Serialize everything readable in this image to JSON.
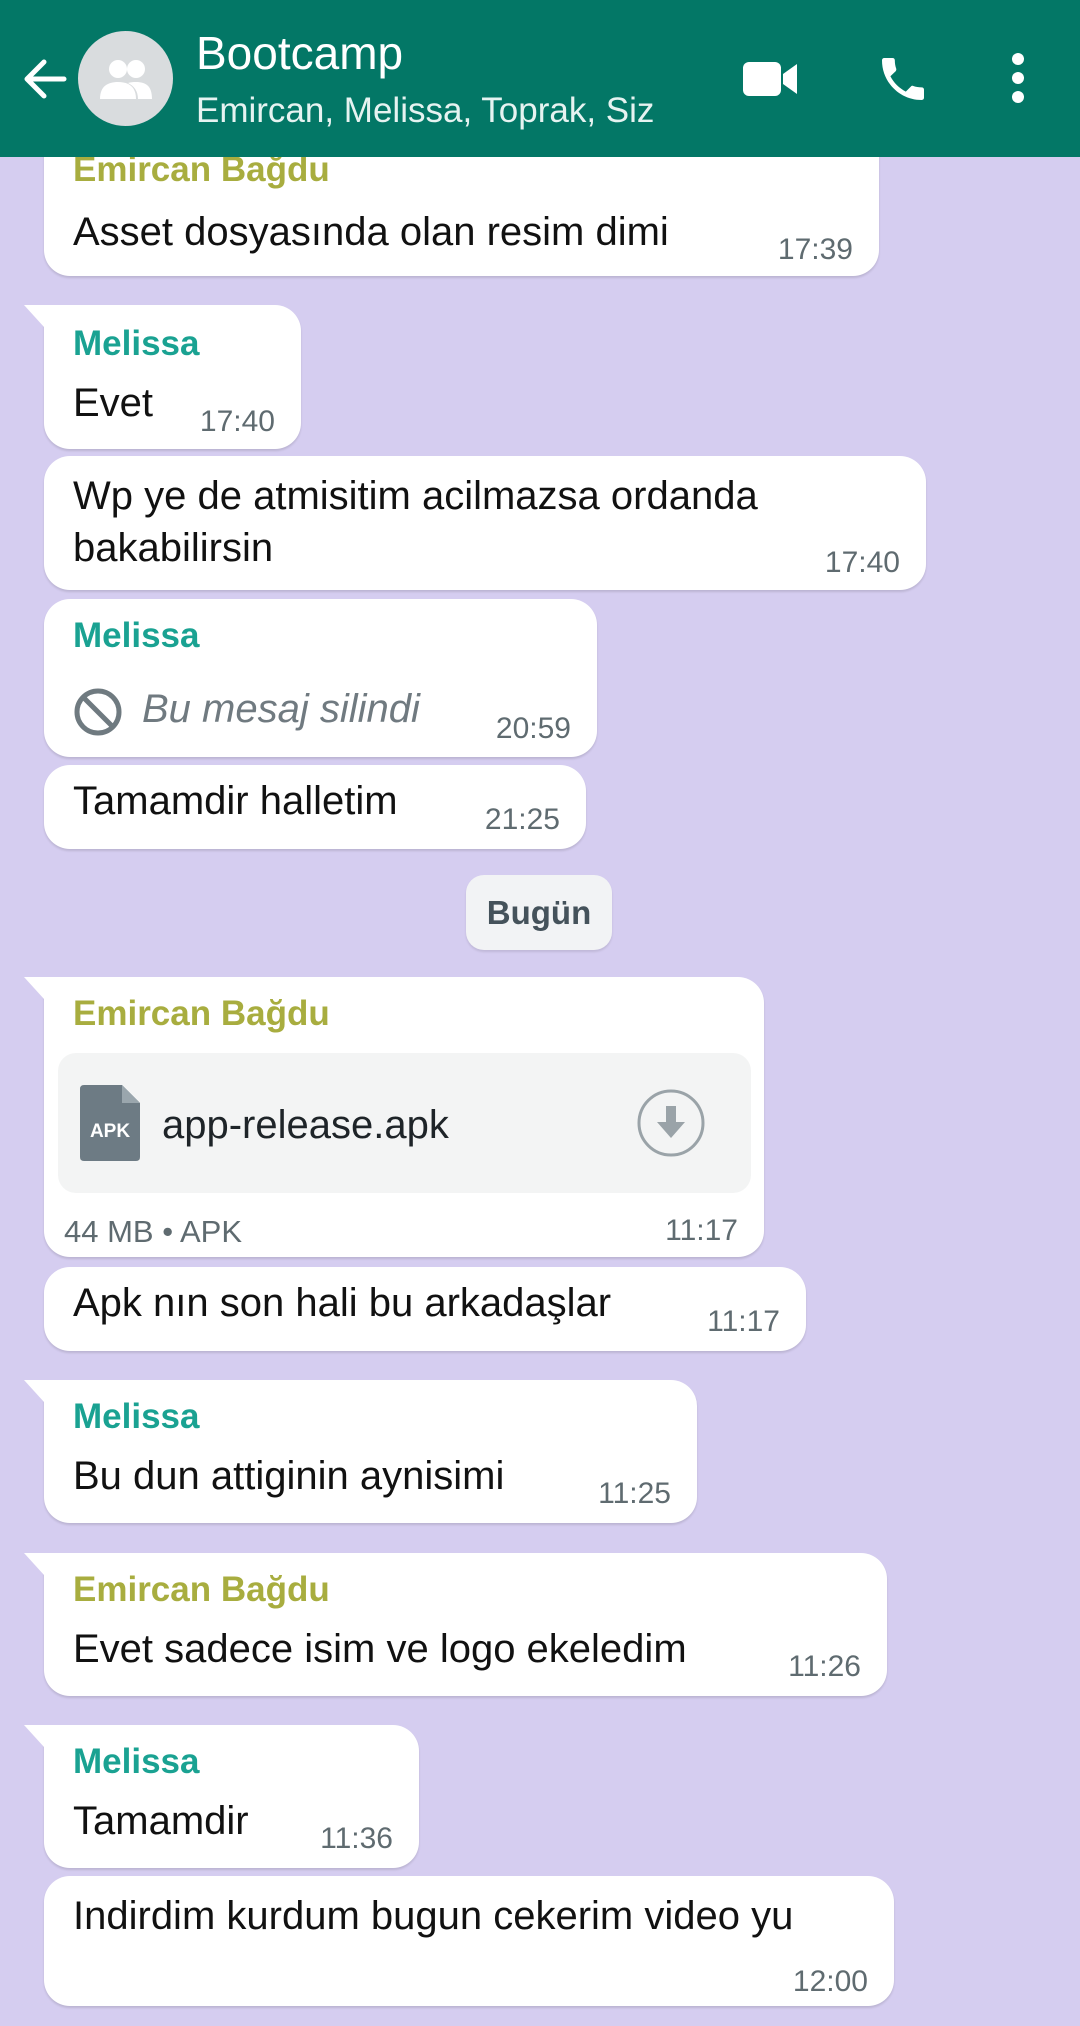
{
  "header": {
    "title": "Bootcamp",
    "subtitle": "Emircan, Melissa, Toprak, Siz"
  },
  "colors": {
    "header": "#037766",
    "chat_background": "#d5cdf0",
    "sender_emircan": "#a8ad3f",
    "sender_melissa": "#1aa292"
  },
  "messages": [
    {
      "sender": "Emircan Bağdu",
      "text": "Asset dosyasında olan resim dimi",
      "time": "17:39"
    },
    {
      "sender": "Melissa",
      "text": "Evet",
      "time": "17:40"
    },
    {
      "line1": "Wp ye de atmisitim acilmazsa ordanda",
      "line2": "bakabilirsin",
      "time": "17:40"
    },
    {
      "sender": "Melissa",
      "text": "Bu mesaj silindi",
      "time": "20:59"
    },
    {
      "text": "Tamamdir halletim",
      "time": "21:25"
    },
    {
      "sender": "Emircan Bağdu",
      "file_name": "app-release.apk",
      "file_badge": "APK",
      "file_meta": "44 MB • APK",
      "time": "11:17"
    },
    {
      "text": "Apk nın son hali bu arkadaşlar",
      "time": "11:17"
    },
    {
      "sender": "Melissa",
      "text": "Bu dun attiginin aynisimi",
      "time": "11:25"
    },
    {
      "sender": "Emircan Bağdu",
      "text": "Evet sadece isim ve logo ekeledim",
      "time": "11:26"
    },
    {
      "sender": "Melissa",
      "text": "Tamamdir",
      "time": "11:36"
    },
    {
      "text": "Indirdim kurdum bugun cekerim video yu",
      "time": "12:00"
    }
  ],
  "date_separator": "Bugün",
  "icons": [
    "back-arrow-icon",
    "group-avatar-icon",
    "video-call-icon",
    "voice-call-icon",
    "more-options-icon",
    "deleted-message-icon",
    "apk-file-icon",
    "download-icon"
  ]
}
